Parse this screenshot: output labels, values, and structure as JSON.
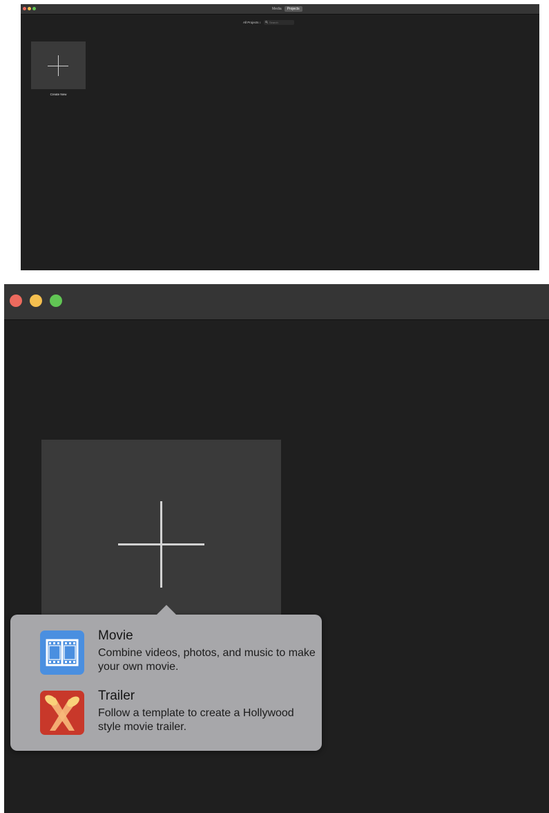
{
  "small_window": {
    "segmented": {
      "media_label": "Media",
      "projects_label": "Projects"
    },
    "filter_label": "All Projects ↕",
    "search_placeholder": "Search",
    "tile_label": "Create New"
  },
  "popover": {
    "items": [
      {
        "title": "Movie",
        "description": "Combine videos, photos, and music to make your own movie.",
        "icon": "film-strip-icon"
      },
      {
        "title": "Trailer",
        "description": "Follow a template to create a Hollywood style movie trailer.",
        "icon": "spotlights-icon"
      }
    ]
  },
  "colors": {
    "window_bg": "#1f1f1f",
    "titlebar": "#353535",
    "tile": "#3a3a3a",
    "popover": "#a7a7aa",
    "close": "#ec6a5e",
    "minimize": "#f4bf4f",
    "zoom": "#61c554",
    "movie_icon": "#4a8fe0",
    "trailer_icon": "#c8382a"
  }
}
